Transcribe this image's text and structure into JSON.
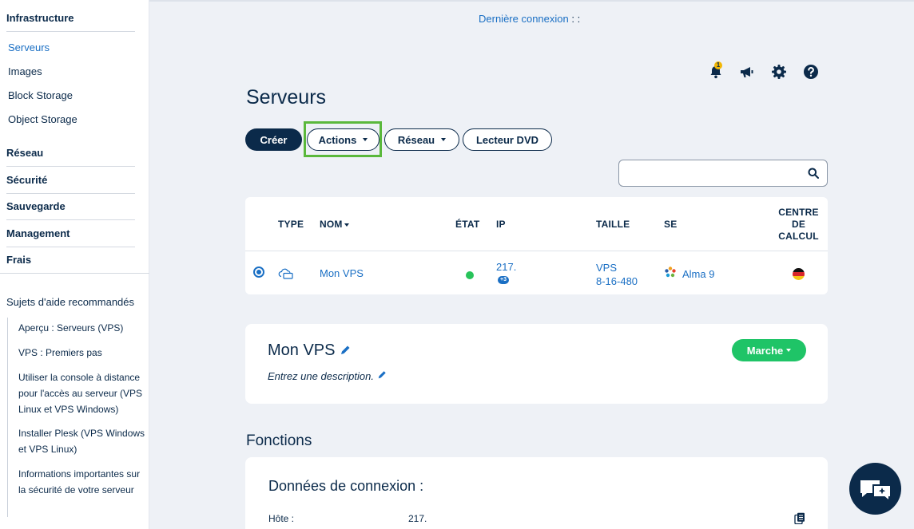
{
  "sidebar": {
    "infrastructure": "Infrastructure",
    "sub_items": [
      "Serveurs",
      "Images",
      "Block Storage",
      "Object Storage"
    ],
    "sections": [
      "Réseau",
      "Sécurité",
      "Sauvegarde",
      "Management",
      "Frais"
    ],
    "help_title": "Sujets d'aide recommandés",
    "help_links": [
      "Aperçu : Serveurs (VPS)",
      "VPS : Premiers pas",
      "Utiliser la console à distance pour l'accès au serveur (VPS Linux et VPS Windows)",
      "Installer Plesk (VPS Windows et VPS Linux)",
      "Informations importantes sur la sécurité de votre serveur"
    ]
  },
  "header": {
    "last_login_label": "Dernière connexion",
    "last_login_colon": " : :",
    "notification_count": "1",
    "icons": [
      "bell-icon",
      "megaphone-icon",
      "gear-icon",
      "help-icon"
    ]
  },
  "page_title": "Serveurs",
  "toolbar": {
    "create": "Créer",
    "actions": "Actions",
    "network": "Réseau",
    "dvd": "Lecteur DVD"
  },
  "table": {
    "headers": {
      "type": "TYPE",
      "name": "NOM",
      "state": "ÉTAT",
      "ip": "IP",
      "size": "TAILLE",
      "os": "SE",
      "dc_line1": "CENTRE",
      "dc_line2": "DE",
      "dc_line3": "CALCUL"
    },
    "row": {
      "name": "Mon VPS",
      "ip": "217.",
      "ip_extra": "+3",
      "size_line1": "VPS",
      "size_line2": "8-16-480",
      "os": "Alma 9",
      "status_color": "#28c35a"
    }
  },
  "vps_card": {
    "name": "Mon VPS",
    "description": "Entrez une description.",
    "state_button": "Marche"
  },
  "functions_title": "Fonctions",
  "connection": {
    "title": "Données de connexion :",
    "host_label": "Hôte :",
    "host_value": "217."
  },
  "colors": {
    "navy": "#0b2a4a",
    "link": "#1a6fc4",
    "green": "#1fc467",
    "highlight": "#5ab83c"
  }
}
